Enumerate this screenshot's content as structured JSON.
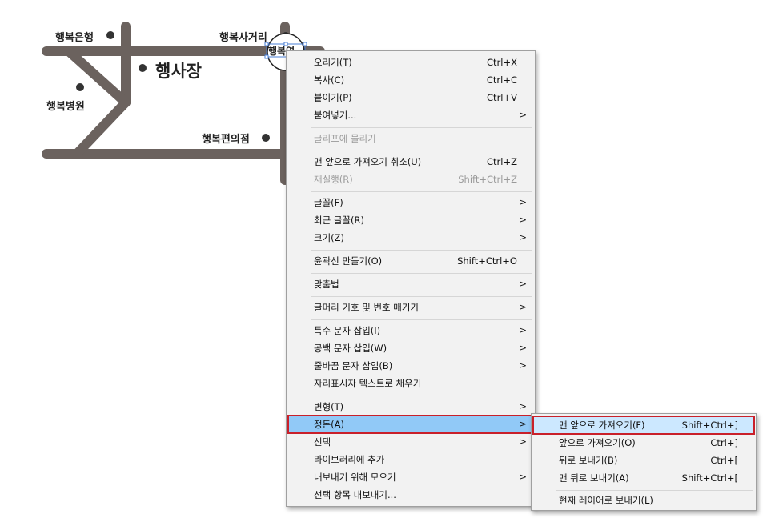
{
  "map": {
    "labels": {
      "bank": "행복은행",
      "crossroad": "행복사거리",
      "station": "행복역",
      "plaza": "행사장",
      "hospital": "행복병원",
      "store": "행복편의점"
    },
    "road_color": "#6b625e"
  },
  "context_menu": {
    "items": {
      "cut": {
        "label": "오리기(T)",
        "shortcut": "Ctrl+X"
      },
      "copy": {
        "label": "복사(C)",
        "shortcut": "Ctrl+C"
      },
      "paste": {
        "label": "붙이기(P)",
        "shortcut": "Ctrl+V"
      },
      "paste_special": {
        "label": "붙여넣기...",
        "arrow": ">"
      },
      "snap_glyph": {
        "label": "글리프에 물리기"
      },
      "undo": {
        "label": "맨 앞으로 가져오기 취소(U)",
        "shortcut": "Ctrl+Z"
      },
      "redo": {
        "label": "재실행(R)",
        "shortcut": "Shift+Ctrl+Z"
      },
      "font": {
        "label": "글꼴(F)",
        "arrow": ">"
      },
      "recent_font": {
        "label": "최근 글꼴(R)",
        "arrow": ">"
      },
      "size": {
        "label": "크기(Z)",
        "arrow": ">"
      },
      "outline": {
        "label": "윤곽선 만들기(O)",
        "shortcut": "Shift+Ctrl+O"
      },
      "spelling": {
        "label": "맞춤법",
        "arrow": ">"
      },
      "bullets": {
        "label": "글머리 기호 및 번호 매기기",
        "arrow": ">"
      },
      "special_char": {
        "label": "특수 문자 삽입(I)",
        "arrow": ">"
      },
      "whitespace": {
        "label": "공백 문자 삽입(W)",
        "arrow": ">"
      },
      "break_char": {
        "label": "줄바꿈 문자 삽입(B)",
        "arrow": ">"
      },
      "placeholder": {
        "label": "자리표시자 텍스트로 채우기"
      },
      "transform": {
        "label": "변형(T)",
        "arrow": ">"
      },
      "arrange": {
        "label": "정돈(A)",
        "arrow": ">"
      },
      "select": {
        "label": "선택",
        "arrow": ">"
      },
      "add_library": {
        "label": "라이브러리에 추가"
      },
      "collect_export": {
        "label": "내보내기 위해 모으기",
        "arrow": ">"
      },
      "export_selection": {
        "label": "선택 항목 내보내기..."
      }
    }
  },
  "submenu": {
    "items": {
      "bring_front": {
        "label": "맨 앞으로 가져오기(F)",
        "shortcut": "Shift+Ctrl+]"
      },
      "bring_forward": {
        "label": "앞으로 가져오기(O)",
        "shortcut": "Ctrl+]"
      },
      "send_backward": {
        "label": "뒤로 보내기(B)",
        "shortcut": "Ctrl+["
      },
      "send_back": {
        "label": "맨 뒤로 보내기(A)",
        "shortcut": "Shift+Ctrl+["
      },
      "current_layer": {
        "label": "현재 레이어로 보내기(L)"
      }
    }
  }
}
